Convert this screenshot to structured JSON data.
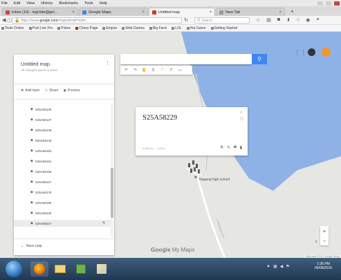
{
  "browser": {
    "menu": [
      "File",
      "Edit",
      "View",
      "History",
      "Bookmarks",
      "Tools",
      "Help"
    ],
    "tabs": [
      {
        "label": "Inbox (10) - mgl.lide@gm...",
        "color": "#d44638",
        "active": false
      },
      {
        "label": "Google Maps",
        "color": "#4285f4",
        "active": false
      },
      {
        "label": "Untitled map",
        "color": "#d93025",
        "active": true
      },
      {
        "label": "New Tab",
        "color": "#888888",
        "active": false
      }
    ],
    "new_tab": "+",
    "url_prefix": "https://www.",
    "url_domain": "google.com",
    "url_rest": "/maps/d/edit?mid=...",
    "search_placeholder": "Search",
    "bookmarks": [
      "Tools Online",
      "Pool Live Pro",
      "Pokes",
      "Chess Page",
      "Empire",
      "Web Games",
      "Big Farm",
      "LOL",
      "Hot Game",
      "Getting Started"
    ]
  },
  "mymaps": {
    "title": "Untitled map",
    "subtitle": "All changes saved in Drive",
    "actions": {
      "add_layer": "Add layer",
      "share": "Share",
      "preview": "Preview"
    },
    "layer_items": [
      "S25A58136",
      "S25A58137",
      "S25A58139",
      "S25A58149",
      "S25A58152",
      "S25A58154",
      "S25A58156",
      "S25A58157",
      "S25A58179",
      "S25A58196",
      "S25A58226",
      "S25A58227"
    ],
    "selected_index": 11,
    "base_map": "Base map",
    "info_card": {
      "title": "S25A58229",
      "meta": [
        "0.000 km",
        "120 m"
      ]
    },
    "place_label": "Nagaraj high school",
    "road_label": "Kadabagere Rd",
    "branding_google": "Google",
    "branding_product": "My Maps",
    "map_footer": "Map data ©2017 Google  Terms"
  },
  "taskbar": {
    "time": "1:36 PM",
    "date": "06/06/2016"
  },
  "colors": {
    "water": "#8fb2e6",
    "land": "#e6e6e2",
    "accent": "#4285f4",
    "avatar": "#f29632"
  }
}
